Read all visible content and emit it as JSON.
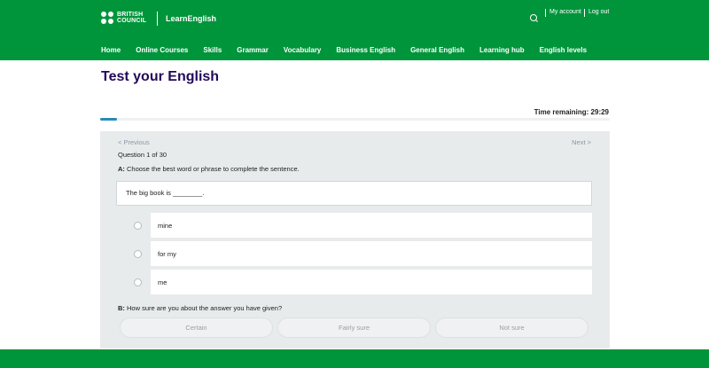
{
  "header": {
    "logo_line1": "BRITISH",
    "logo_line2": "COUNCIL",
    "site_name": "LearnEnglish",
    "my_account": "My account",
    "log_out": "Log out",
    "search_icon": "search-icon"
  },
  "nav": {
    "items": [
      "Home",
      "Online Courses",
      "Skills",
      "Grammar",
      "Vocabulary",
      "Business English",
      "General English",
      "Learning hub",
      "English levels"
    ]
  },
  "page": {
    "title": "Test your English",
    "timer": "Time remaining: 29:29",
    "progress_fraction": 0.033
  },
  "quiz": {
    "previous": "< Previous",
    "next": "Next >",
    "question_number": "Question 1 of 30",
    "part_a_label": "A:",
    "part_a_text": " Choose the best word or phrase to complete the sentence.",
    "sentence": "The big book is ________.",
    "options": [
      "mine",
      "for my",
      "me"
    ],
    "part_b_label": "B:",
    "part_b_text": " How sure are you about the answer you have given?",
    "confidence": [
      "Certain",
      "Fairly sure",
      "Not sure"
    ]
  },
  "colors": {
    "brand_green": "#00953b",
    "title_purple": "#23085a",
    "progress_blue": "#2a8ab8"
  }
}
